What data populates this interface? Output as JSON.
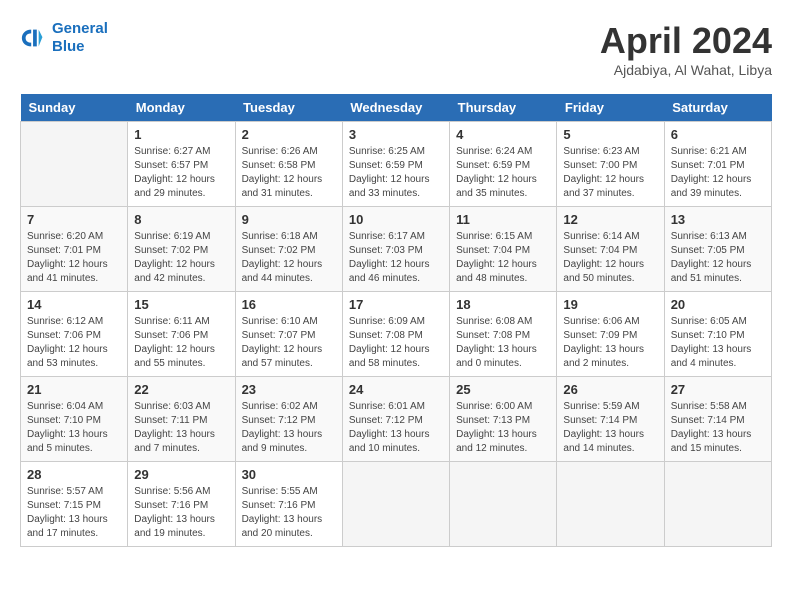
{
  "header": {
    "logo_line1": "General",
    "logo_line2": "Blue",
    "title": "April 2024",
    "location": "Ajdabiya, Al Wahat, Libya"
  },
  "days_of_week": [
    "Sunday",
    "Monday",
    "Tuesday",
    "Wednesday",
    "Thursday",
    "Friday",
    "Saturday"
  ],
  "weeks": [
    [
      {
        "day": "",
        "empty": true
      },
      {
        "day": "1",
        "sunrise": "6:27 AM",
        "sunset": "6:57 PM",
        "daylight": "12 hours and 29 minutes."
      },
      {
        "day": "2",
        "sunrise": "6:26 AM",
        "sunset": "6:58 PM",
        "daylight": "12 hours and 31 minutes."
      },
      {
        "day": "3",
        "sunrise": "6:25 AM",
        "sunset": "6:59 PM",
        "daylight": "12 hours and 33 minutes."
      },
      {
        "day": "4",
        "sunrise": "6:24 AM",
        "sunset": "6:59 PM",
        "daylight": "12 hours and 35 minutes."
      },
      {
        "day": "5",
        "sunrise": "6:23 AM",
        "sunset": "7:00 PM",
        "daylight": "12 hours and 37 minutes."
      },
      {
        "day": "6",
        "sunrise": "6:21 AM",
        "sunset": "7:01 PM",
        "daylight": "12 hours and 39 minutes."
      }
    ],
    [
      {
        "day": "7",
        "sunrise": "6:20 AM",
        "sunset": "7:01 PM",
        "daylight": "12 hours and 41 minutes."
      },
      {
        "day": "8",
        "sunrise": "6:19 AM",
        "sunset": "7:02 PM",
        "daylight": "12 hours and 42 minutes."
      },
      {
        "day": "9",
        "sunrise": "6:18 AM",
        "sunset": "7:02 PM",
        "daylight": "12 hours and 44 minutes."
      },
      {
        "day": "10",
        "sunrise": "6:17 AM",
        "sunset": "7:03 PM",
        "daylight": "12 hours and 46 minutes."
      },
      {
        "day": "11",
        "sunrise": "6:15 AM",
        "sunset": "7:04 PM",
        "daylight": "12 hours and 48 minutes."
      },
      {
        "day": "12",
        "sunrise": "6:14 AM",
        "sunset": "7:04 PM",
        "daylight": "12 hours and 50 minutes."
      },
      {
        "day": "13",
        "sunrise": "6:13 AM",
        "sunset": "7:05 PM",
        "daylight": "12 hours and 51 minutes."
      }
    ],
    [
      {
        "day": "14",
        "sunrise": "6:12 AM",
        "sunset": "7:06 PM",
        "daylight": "12 hours and 53 minutes."
      },
      {
        "day": "15",
        "sunrise": "6:11 AM",
        "sunset": "7:06 PM",
        "daylight": "12 hours and 55 minutes."
      },
      {
        "day": "16",
        "sunrise": "6:10 AM",
        "sunset": "7:07 PM",
        "daylight": "12 hours and 57 minutes."
      },
      {
        "day": "17",
        "sunrise": "6:09 AM",
        "sunset": "7:08 PM",
        "daylight": "12 hours and 58 minutes."
      },
      {
        "day": "18",
        "sunrise": "6:08 AM",
        "sunset": "7:08 PM",
        "daylight": "13 hours and 0 minutes."
      },
      {
        "day": "19",
        "sunrise": "6:06 AM",
        "sunset": "7:09 PM",
        "daylight": "13 hours and 2 minutes."
      },
      {
        "day": "20",
        "sunrise": "6:05 AM",
        "sunset": "7:10 PM",
        "daylight": "13 hours and 4 minutes."
      }
    ],
    [
      {
        "day": "21",
        "sunrise": "6:04 AM",
        "sunset": "7:10 PM",
        "daylight": "13 hours and 5 minutes."
      },
      {
        "day": "22",
        "sunrise": "6:03 AM",
        "sunset": "7:11 PM",
        "daylight": "13 hours and 7 minutes."
      },
      {
        "day": "23",
        "sunrise": "6:02 AM",
        "sunset": "7:12 PM",
        "daylight": "13 hours and 9 minutes."
      },
      {
        "day": "24",
        "sunrise": "6:01 AM",
        "sunset": "7:12 PM",
        "daylight": "13 hours and 10 minutes."
      },
      {
        "day": "25",
        "sunrise": "6:00 AM",
        "sunset": "7:13 PM",
        "daylight": "13 hours and 12 minutes."
      },
      {
        "day": "26",
        "sunrise": "5:59 AM",
        "sunset": "7:14 PM",
        "daylight": "13 hours and 14 minutes."
      },
      {
        "day": "27",
        "sunrise": "5:58 AM",
        "sunset": "7:14 PM",
        "daylight": "13 hours and 15 minutes."
      }
    ],
    [
      {
        "day": "28",
        "sunrise": "5:57 AM",
        "sunset": "7:15 PM",
        "daylight": "13 hours and 17 minutes."
      },
      {
        "day": "29",
        "sunrise": "5:56 AM",
        "sunset": "7:16 PM",
        "daylight": "13 hours and 19 minutes."
      },
      {
        "day": "30",
        "sunrise": "5:55 AM",
        "sunset": "7:16 PM",
        "daylight": "13 hours and 20 minutes."
      },
      {
        "day": "",
        "empty": true
      },
      {
        "day": "",
        "empty": true
      },
      {
        "day": "",
        "empty": true
      },
      {
        "day": "",
        "empty": true
      }
    ]
  ]
}
